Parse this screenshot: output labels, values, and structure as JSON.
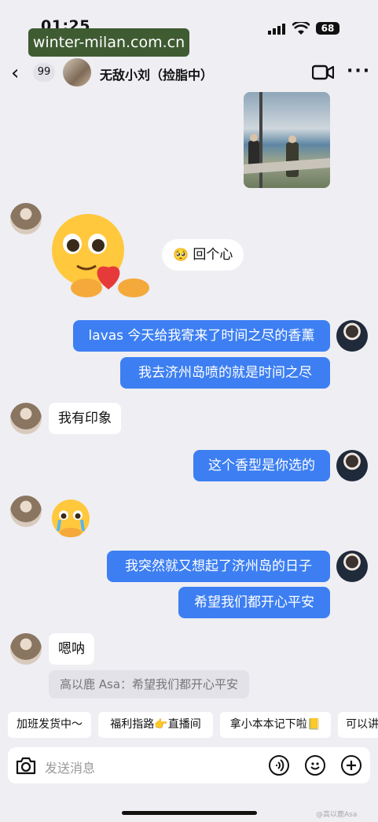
{
  "status": {
    "time": "01:25",
    "battery": "68"
  },
  "watermark": "winter-milan.com.cn",
  "header": {
    "unread_count": "99",
    "title": "无敌小刘（捡脂中）"
  },
  "messages": [
    {
      "side": "in",
      "text": "回个心"
    },
    {
      "side": "out",
      "text": "lavas 今天给我寄来了时间之尽的香薰"
    },
    {
      "side": "out",
      "text": "我去济州岛喷的就是时间之尽"
    },
    {
      "side": "in",
      "text": "我有印象"
    },
    {
      "side": "out",
      "text": "这个香型是你选的"
    },
    {
      "side": "out",
      "text": "我突然就又想起了济州岛的日子"
    },
    {
      "side": "out",
      "text": "希望我们都开心平安"
    },
    {
      "side": "in",
      "text": "嗯呐"
    }
  ],
  "quote": "高以鹿 Asa：希望我们都开心平安",
  "quick_replies": [
    "加班发货中～",
    "福利指路👉直播间",
    "拿小本本记下啦📒",
    "可以讲"
  ],
  "input": {
    "placeholder": "发送消息"
  },
  "footer_watermark": "@高以鹿Asa"
}
